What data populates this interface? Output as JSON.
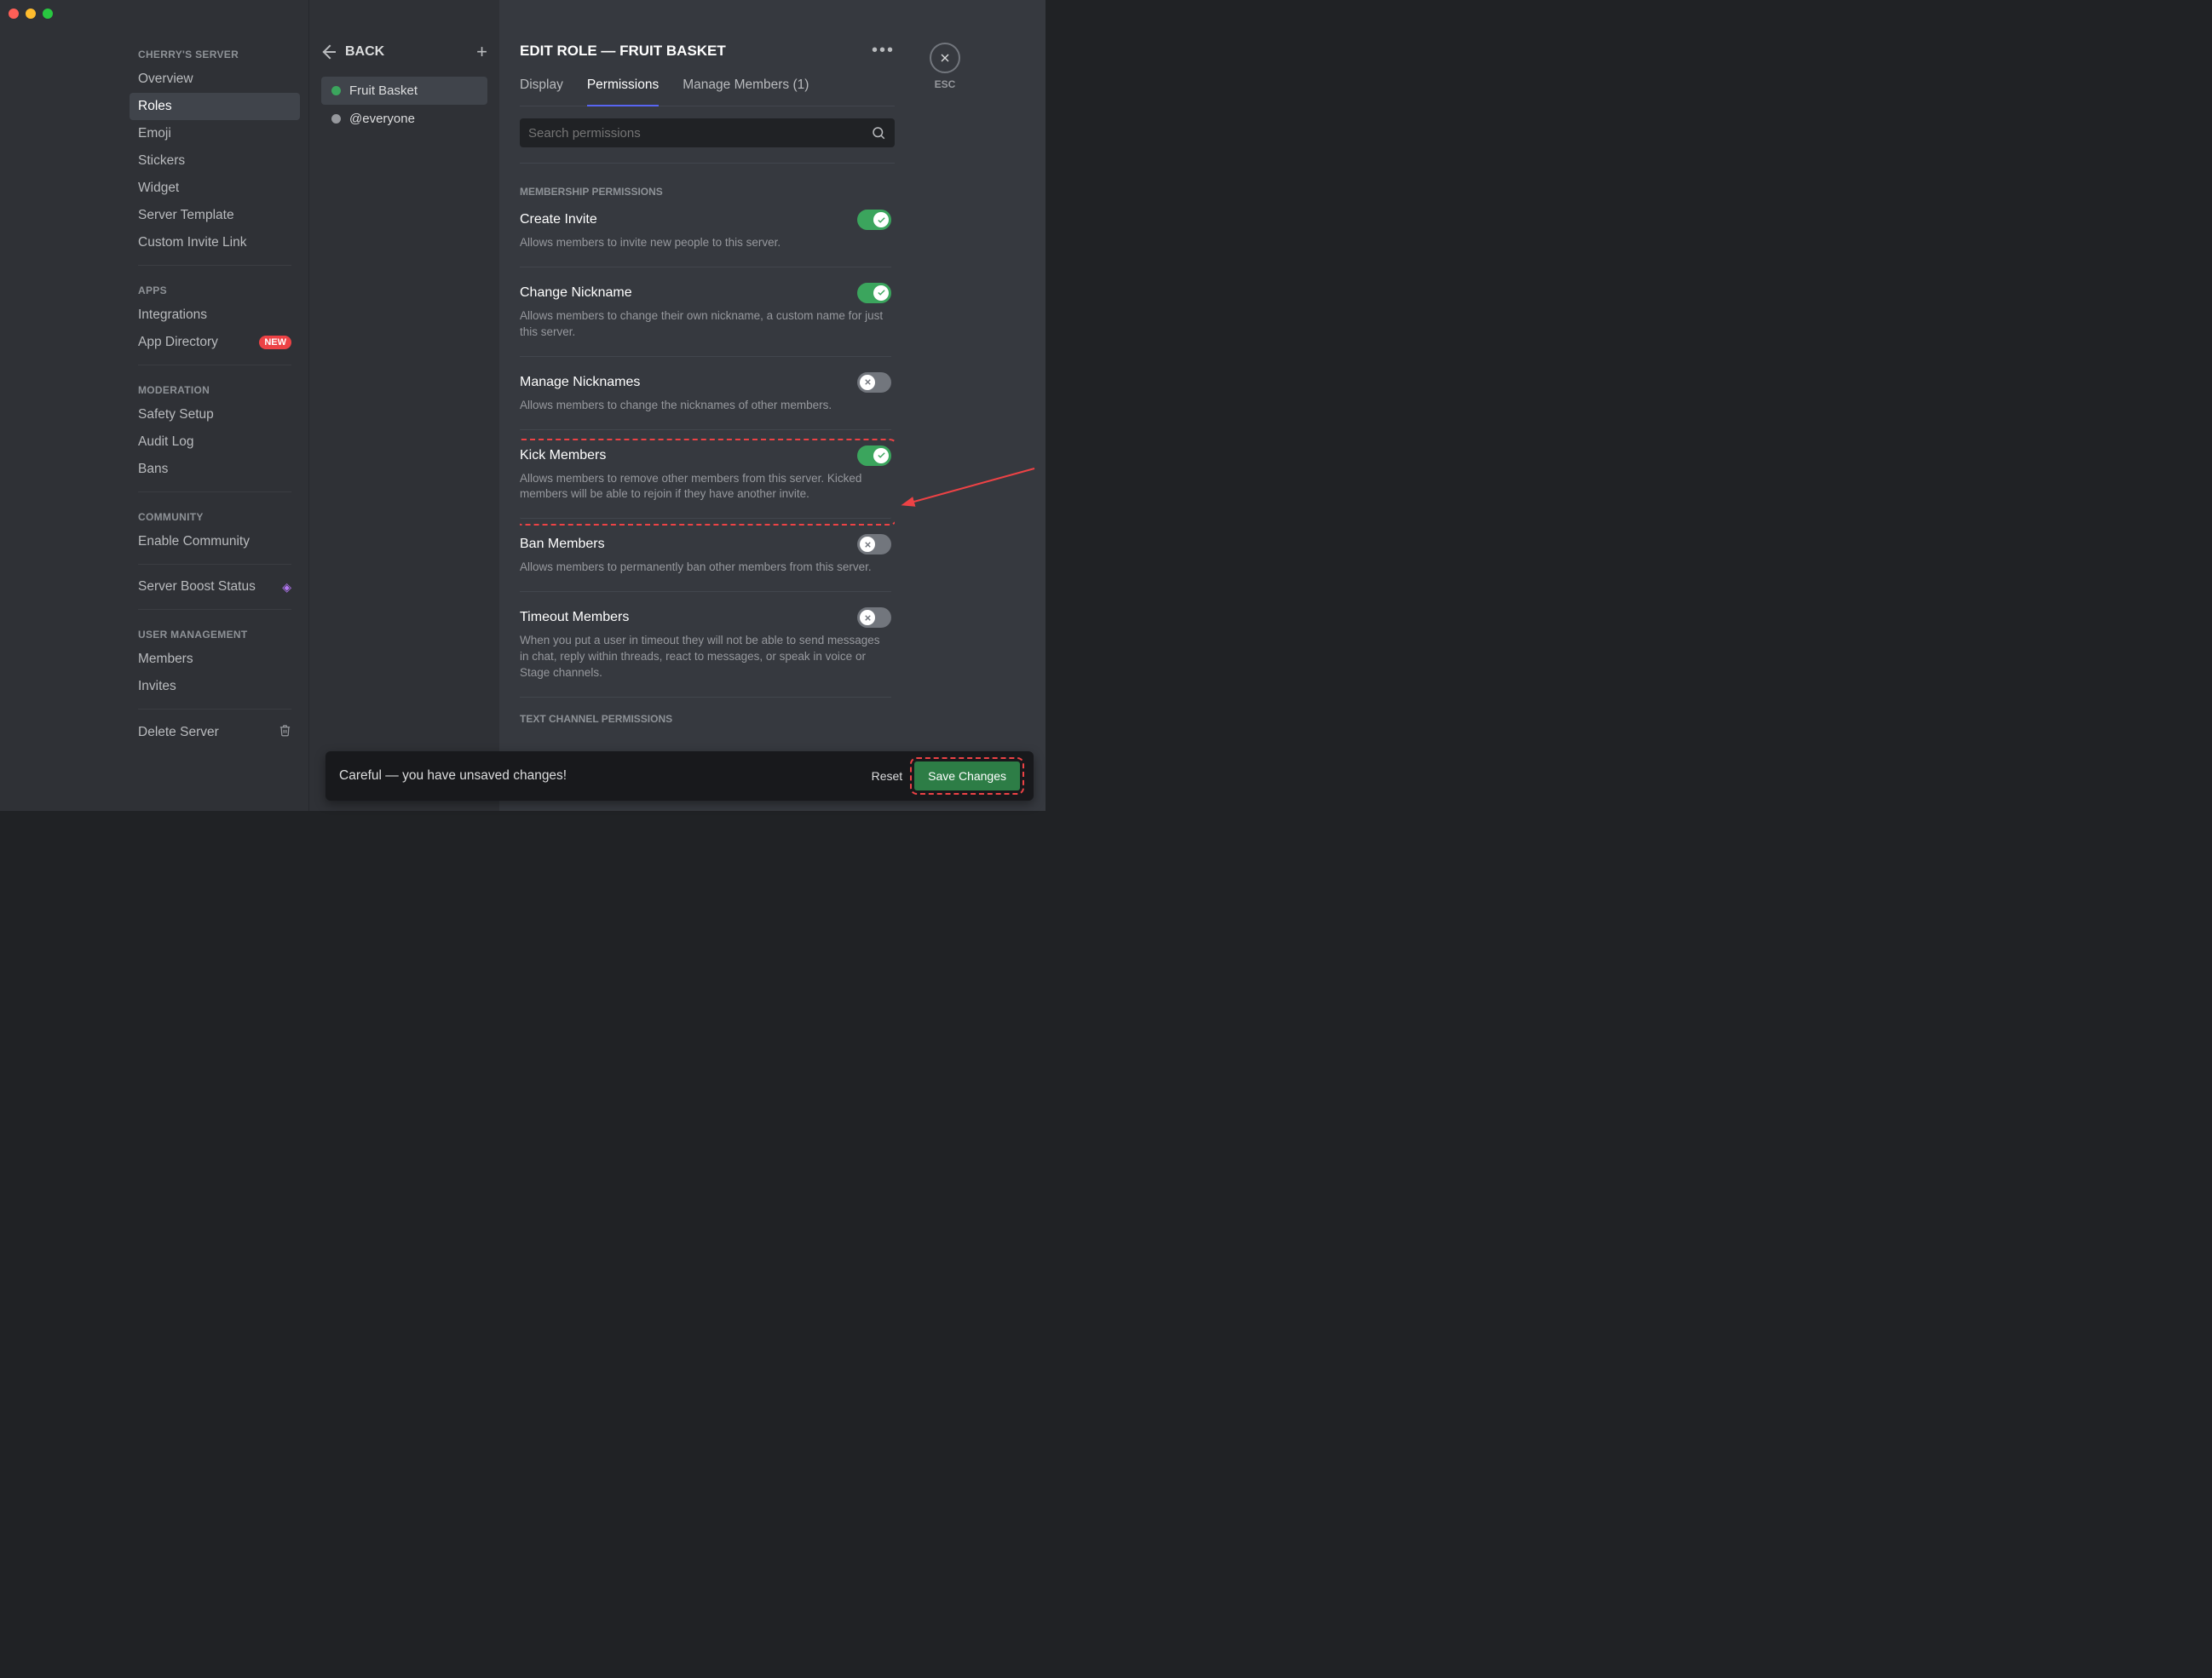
{
  "server_name": "CHERRY'S SERVER",
  "sidebar": {
    "groups": [
      {
        "header": "CHERRY'S SERVER",
        "items": [
          {
            "label": "Overview"
          },
          {
            "label": "Roles",
            "selected": true
          },
          {
            "label": "Emoji"
          },
          {
            "label": "Stickers"
          },
          {
            "label": "Widget"
          },
          {
            "label": "Server Template"
          },
          {
            "label": "Custom Invite Link"
          }
        ]
      },
      {
        "header": "APPS",
        "items": [
          {
            "label": "Integrations"
          },
          {
            "label": "App Directory",
            "badge": "NEW"
          }
        ]
      },
      {
        "header": "MODERATION",
        "items": [
          {
            "label": "Safety Setup"
          },
          {
            "label": "Audit Log"
          },
          {
            "label": "Bans"
          }
        ]
      },
      {
        "header": "COMMUNITY",
        "items": [
          {
            "label": "Enable Community"
          }
        ]
      },
      {
        "boost_item": {
          "label": "Server Boost Status"
        }
      },
      {
        "header": "USER MANAGEMENT",
        "items": [
          {
            "label": "Members"
          },
          {
            "label": "Invites"
          }
        ]
      },
      {
        "delete_item": {
          "label": "Delete Server"
        }
      }
    ]
  },
  "roles_panel": {
    "back_label": "BACK",
    "roles": [
      {
        "name": "Fruit Basket",
        "color": "#3ba55d",
        "selected": true
      },
      {
        "name": "@everyone",
        "color": "#96989d",
        "selected": false
      }
    ]
  },
  "main": {
    "title": "EDIT ROLE — FRUIT BASKET",
    "tabs": {
      "display": "Display",
      "permissions": "Permissions",
      "manage_members": "Manage Members (1)"
    },
    "search_placeholder": "Search permissions",
    "sections": [
      {
        "header": "MEMBERSHIP PERMISSIONS",
        "perms": [
          {
            "id": "create-invite",
            "title": "Create Invite",
            "desc": "Allows members to invite new people to this server.",
            "enabled": true
          },
          {
            "id": "change-nickname",
            "title": "Change Nickname",
            "desc": "Allows members to change their own nickname, a custom name for just this server.",
            "enabled": true
          },
          {
            "id": "manage-nicknames",
            "title": "Manage Nicknames",
            "desc": "Allows members to change the nicknames of other members.",
            "enabled": false
          },
          {
            "id": "kick-members",
            "title": "Kick Members",
            "desc": "Allows members to remove other members from this server. Kicked members will be able to rejoin if they have another invite.",
            "enabled": true,
            "highlighted": true
          },
          {
            "id": "ban-members",
            "title": "Ban Members",
            "desc": "Allows members to permanently ban other members from this server.",
            "enabled": false
          },
          {
            "id": "timeout-members",
            "title": "Timeout Members",
            "desc": "When you put a user in timeout they will not be able to send messages in chat, reply within threads, react to messages, or speak in voice or Stage channels.",
            "enabled": false
          }
        ]
      },
      {
        "header": "TEXT CHANNEL PERMISSIONS",
        "perms": []
      }
    ]
  },
  "close": {
    "esc_label": "ESC"
  },
  "savebar": {
    "message": "Careful — you have unsaved changes!",
    "reset": "Reset",
    "save": "Save Changes"
  },
  "colors": {
    "accent_green": "#3ba55d",
    "accent_red": "#ed4245",
    "brand_blurple": "#5865f2"
  }
}
